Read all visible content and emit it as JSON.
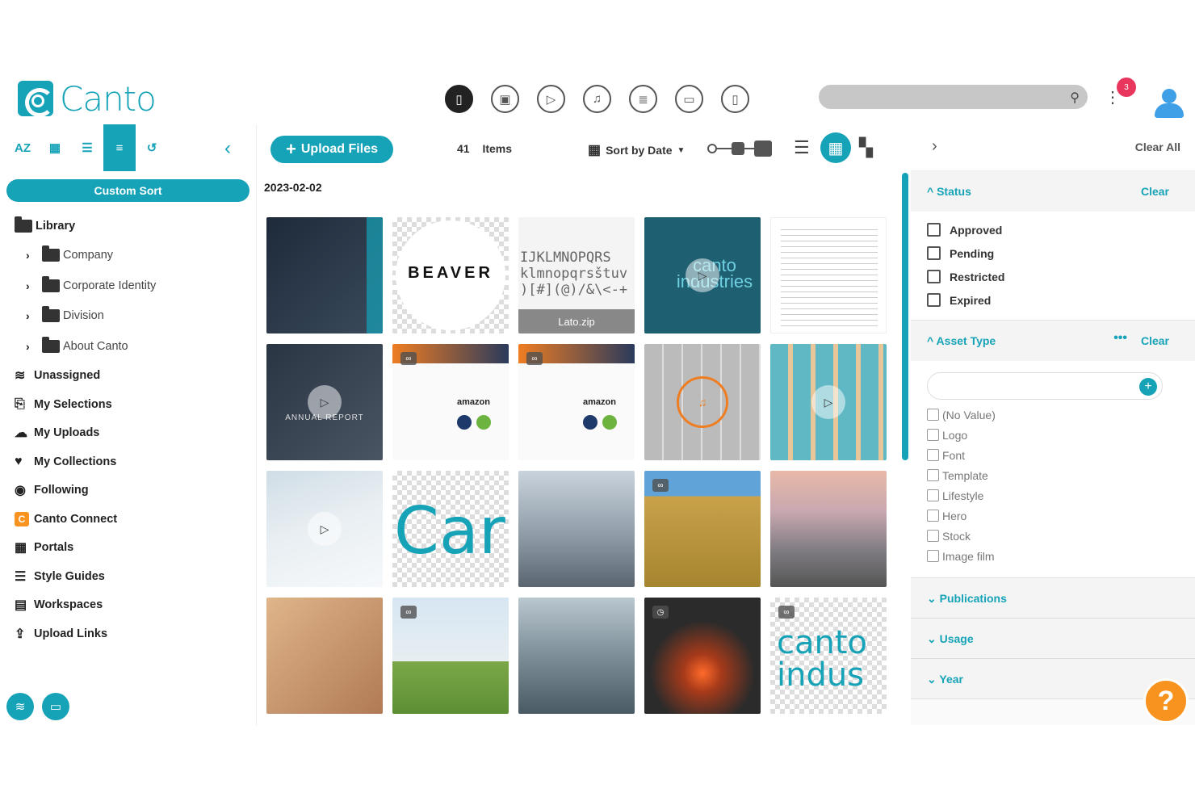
{
  "header": {
    "logo_text": "Canto",
    "asset_type_icons": [
      "all-files-icon",
      "image-icon",
      "video-icon",
      "audio-icon",
      "document-icon",
      "presentation-icon",
      "other-file-icon"
    ],
    "search_placeholder": "",
    "notification_count": "3"
  },
  "sidebar": {
    "sort_buttons": [
      "AZ"
    ],
    "custom_sort_label": "Custom Sort",
    "library_label": "Library",
    "folders": [
      {
        "label": "Company"
      },
      {
        "label": "Corporate Identity"
      },
      {
        "label": "Division"
      },
      {
        "label": "About Canto"
      }
    ],
    "items": [
      {
        "label": "Unassigned",
        "icon": "≋"
      },
      {
        "label": "My Selections",
        "icon": "⎘"
      },
      {
        "label": "My Uploads",
        "icon": "☁"
      },
      {
        "label": "My Collections",
        "icon": "♥"
      },
      {
        "label": "Following",
        "icon": "◉"
      },
      {
        "label": "Canto Connect",
        "icon": "C"
      },
      {
        "label": "Portals",
        "icon": "▦"
      },
      {
        "label": "Style Guides",
        "icon": "☰"
      },
      {
        "label": "Workspaces",
        "icon": "▤"
      },
      {
        "label": "Upload Links",
        "icon": "⇪"
      }
    ]
  },
  "toolbar": {
    "upload_label": "Upload Files",
    "item_count": "41",
    "items_label": "Items",
    "sort_label": "Sort by Date"
  },
  "grid": {
    "date_group": "2023-02-02",
    "tiles": [
      {
        "type": "report-cover",
        "label": ""
      },
      {
        "type": "beaver-logo",
        "label": "BEAVER"
      },
      {
        "type": "font-zip",
        "label": "Lato.zip"
      },
      {
        "type": "canto-industries-video",
        "label": "canto industries"
      },
      {
        "type": "form-document",
        "label": ""
      },
      {
        "type": "annual-report-video",
        "label": "ANNUAL REPORT"
      },
      {
        "type": "amazon-pdf",
        "label": "amazon"
      },
      {
        "type": "amazon-pdf",
        "label": "amazon"
      },
      {
        "type": "photo-grid-audio",
        "label": ""
      },
      {
        "type": "beach-grid-video",
        "label": ""
      },
      {
        "type": "snow-video",
        "label": ""
      },
      {
        "type": "canto-logo",
        "label": "Car"
      },
      {
        "type": "city-photo",
        "label": ""
      },
      {
        "type": "field-photo",
        "label": ""
      },
      {
        "type": "city-photo-2",
        "label": ""
      },
      {
        "type": "hands-photo",
        "label": ""
      },
      {
        "type": "cows-photo",
        "label": ""
      },
      {
        "type": "skyline-photo",
        "label": ""
      },
      {
        "type": "forge-photo",
        "label": ""
      },
      {
        "type": "canto-text-logo",
        "label": "canto indus"
      }
    ]
  },
  "filters": {
    "clear_all_label": "Clear All",
    "status": {
      "title": "Status",
      "clear_label": "Clear",
      "options": [
        "Approved",
        "Pending",
        "Restricted",
        "Expired"
      ]
    },
    "asset_type": {
      "title": "Asset Type",
      "clear_label": "Clear",
      "options": [
        "(No Value)",
        "Logo",
        "Font",
        "Template",
        "Lifestyle",
        "Hero",
        "Stock",
        "Image film"
      ]
    },
    "collapsed_sections": [
      "Publications",
      "Usage",
      "Year"
    ]
  },
  "help_label": "?",
  "colors": {
    "accent": "#16a3b8",
    "notification": "#e8365d",
    "help": "#f7931e"
  }
}
